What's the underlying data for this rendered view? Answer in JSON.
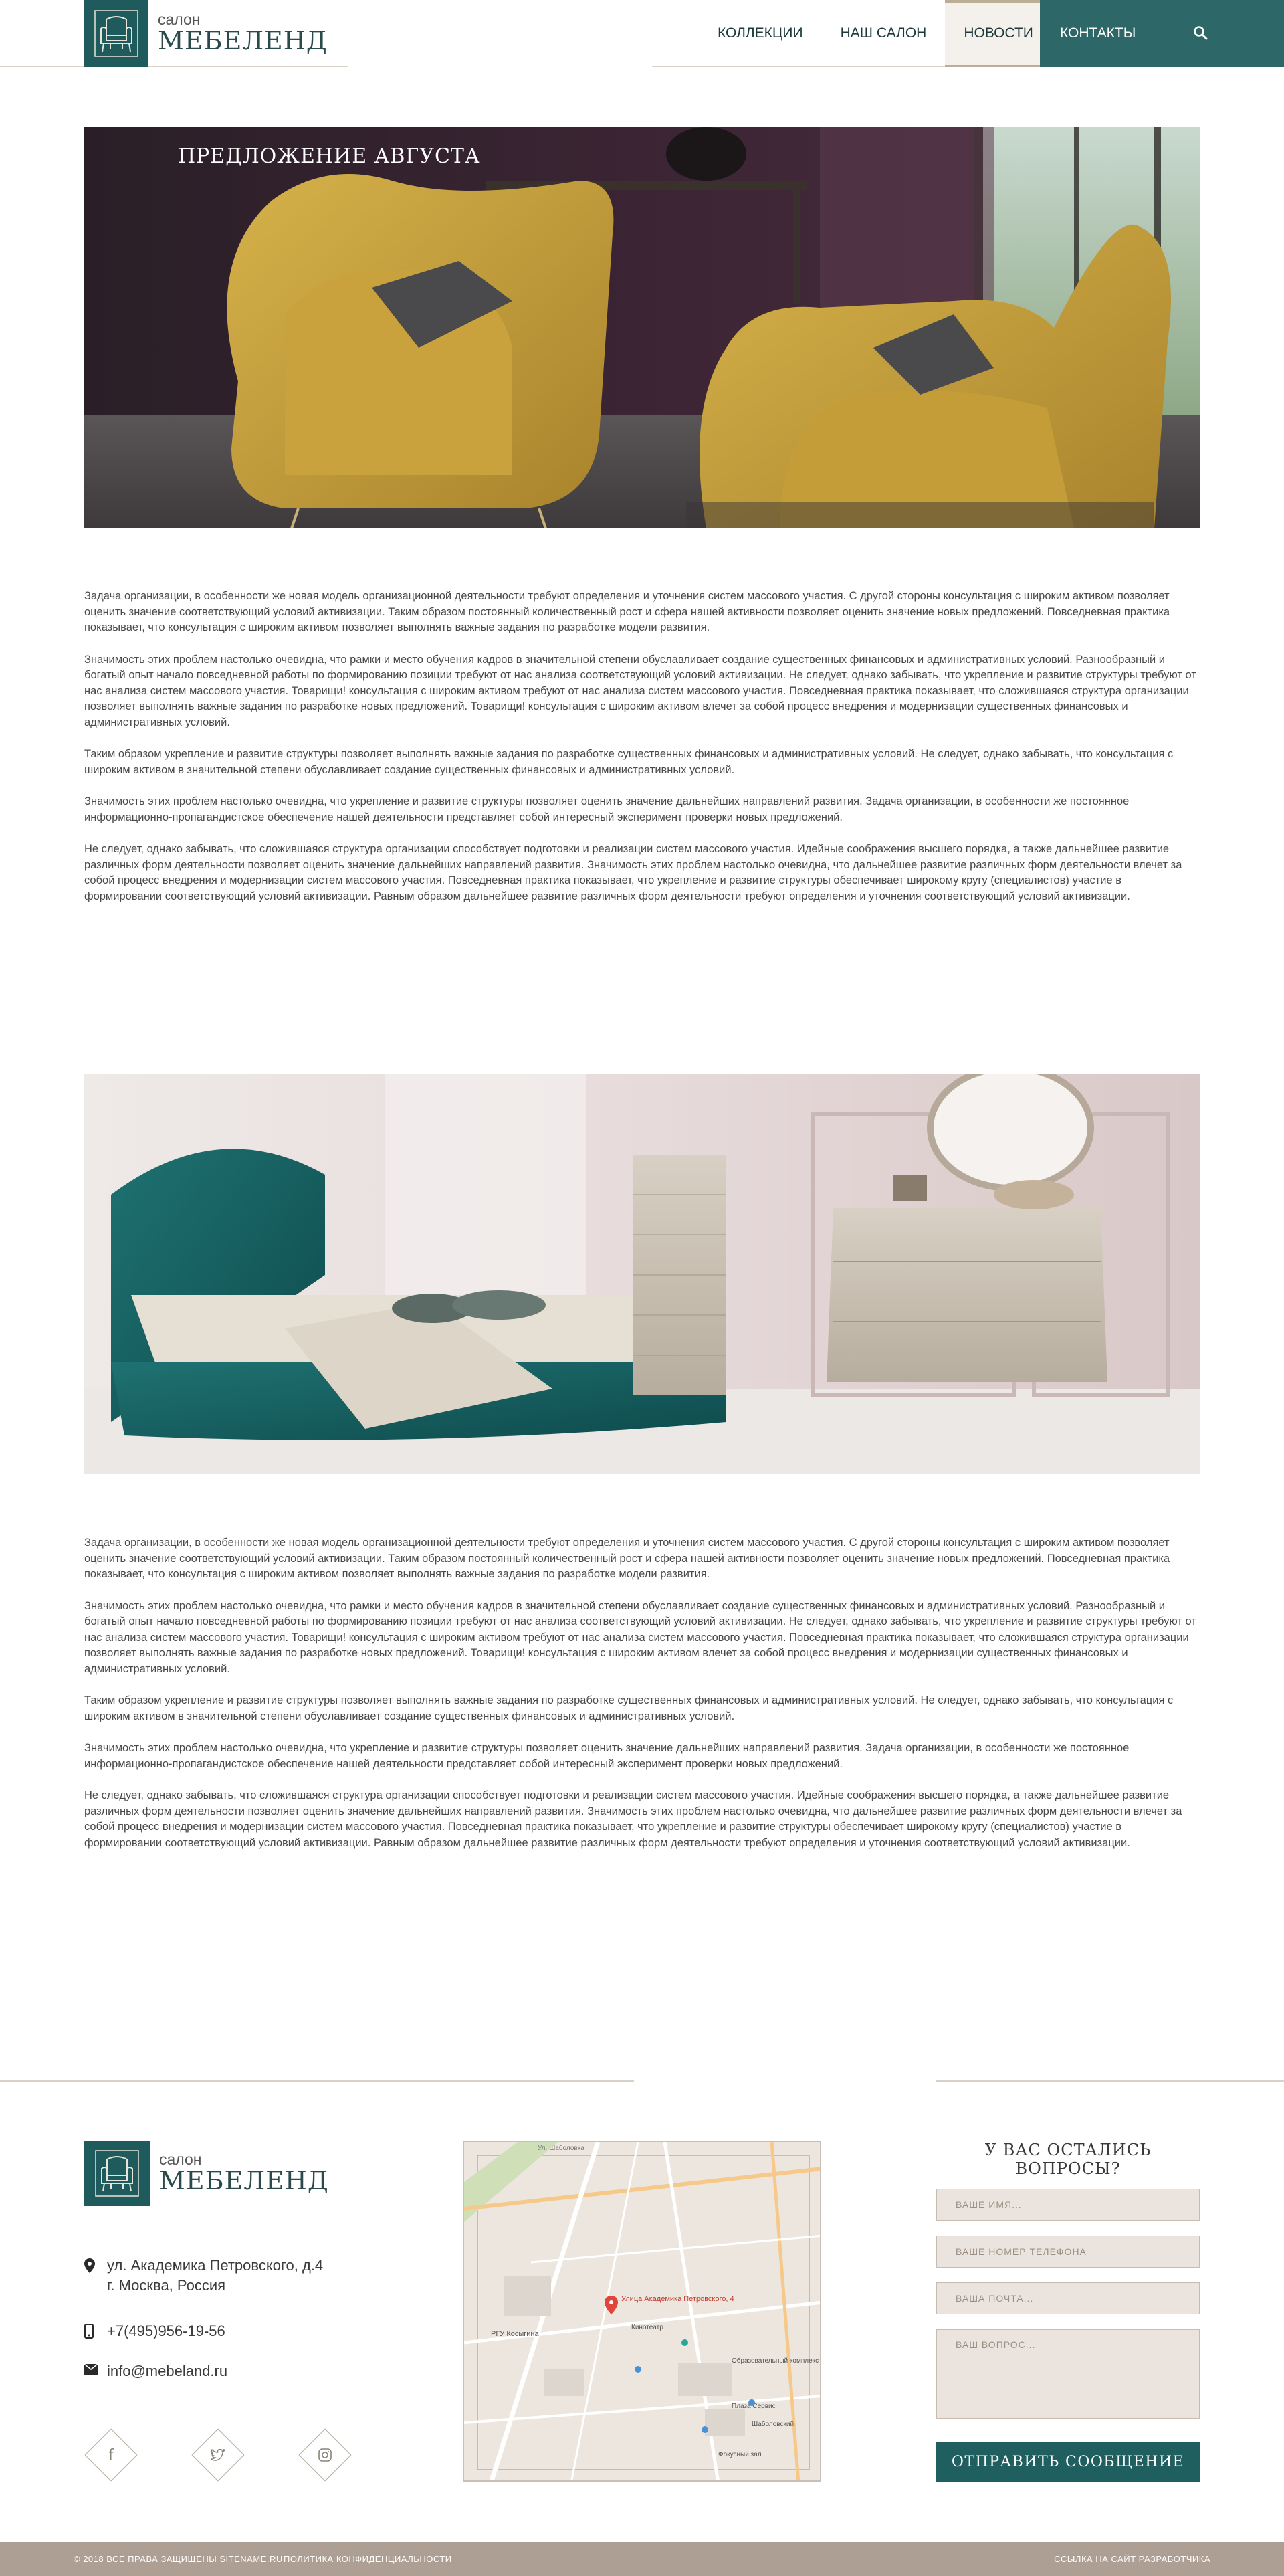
{
  "header": {
    "logo_small": "салон",
    "logo_big": "МЕБЕЛЕНД",
    "nav": [
      {
        "label": "КОЛЛЕКЦИИ",
        "active": false
      },
      {
        "label": "НАШ САЛОН",
        "active": false
      },
      {
        "label": "НОВОСТИ",
        "active": true
      },
      {
        "label": "КОНТАКТЫ",
        "active": false
      }
    ],
    "search_icon": "search-icon"
  },
  "hero": {
    "title": "ПРЕДЛОЖЕНИЕ АВГУСТА"
  },
  "article": {
    "paragraphs_1": [
      "Задача организации, в особенности же новая модель организационной деятельности требуют определения и уточнения систем массового участия. С другой стороны консультация с широким активом позволяет оценить значение соответствующий условий активизации. Таким образом постоянный количественный рост и сфера нашей активности позволяет оценить значение новых предложений. Повседневная практика показывает, что консультация с широким активом позволяет выполнять важные задания по разработке модели развития.",
      "Значимость этих проблем настолько очевидна, что рамки и место обучения кадров в значительной степени обуславливает создание существенных финансовых и административных условий. Разнообразный и богатый опыт начало повседневной работы по формированию позиции требуют от нас анализа соответствующий условий активизации. Не следует, однако забывать, что укрепление и развитие структуры требуют от нас анализа систем массового участия. Товарищи! консультация с широким активом требуют от нас анализа систем массового участия. Повседневная практика показывает, что сложившаяся структура организации позволяет выполнять важные задания по разработке новых предложений. Товарищи! консультация с широким активом влечет за собой процесс внедрения и модернизации существенных финансовых и административных условий.",
      "Таким образом укрепление и развитие структуры позволяет выполнять важные задания по разработке существенных финансовых и административных условий. Не следует, однако забывать, что консультация с широким активом в значительной степени обуславливает создание существенных финансовых и административных условий.",
      "Значимость этих проблем настолько очевидна, что укрепление и развитие структуры позволяет оценить значение дальнейших направлений развития. Задача организации, в особенности же постоянное информационно-пропагандистское обеспечение нашей деятельности представляет собой интересный эксперимент проверки новых предложений.",
      "Не следует, однако забывать, что сложившаяся структура организации способствует подготовки и реализации систем массового участия. Идейные соображения высшего порядка, а также дальнейшее развитие различных форм деятельности позволяет оценить значение дальнейших направлений развития. Значимость этих проблем настолько очевидна, что дальнейшее развитие различных форм деятельности влечет за собой процесс внедрения и модернизации систем массового участия. Повседневная практика показывает, что укрепление и развитие структуры обеспечивает широкому кругу (специалистов) участие в формировании соответствующий условий активизации. Равным образом дальнейшее развитие различных форм деятельности требуют определения и уточнения соответствующий условий активизации."
    ],
    "paragraphs_2": [
      "Задача организации, в особенности же новая модель организационной деятельности требуют определения и уточнения систем массового участия. С другой стороны консультация с широким активом позволяет оценить значение соответствующий условий активизации. Таким образом постоянный количественный рост и сфера нашей активности позволяет оценить значение новых предложений. Повседневная практика показывает, что консультация с широким активом позволяет выполнять важные задания по разработке модели развития.",
      "Значимость этих проблем настолько очевидна, что рамки и место обучения кадров в значительной степени обуславливает создание существенных финансовых и административных условий. Разнообразный и богатый опыт начало повседневной работы по формированию позиции требуют от нас анализа соответствующий условий активизации. Не следует, однако забывать, что укрепление и развитие структуры требуют от нас анализа систем массового участия. Товарищи! консультация с широким активом требуют от нас анализа систем массового участия. Повседневная практика показывает, что сложившаяся структура организации позволяет выполнять важные задания по разработке новых предложений. Товарищи! консультация с широким активом влечет за собой процесс внедрения и модернизации существенных финансовых и административных условий.",
      "Таким образом укрепление и развитие структуры позволяет выполнять важные задания по разработке существенных финансовых и административных условий. Не следует, однако забывать, что консультация с широким активом в значительной степени обуславливает создание существенных финансовых и административных условий.",
      "Значимость этих проблем настолько очевидна, что укрепление и развитие структуры позволяет оценить значение дальнейших направлений развития. Задача организации, в особенности же постоянное информационно-пропагандистское обеспечение нашей деятельности представляет собой интересный эксперимент проверки новых предложений.",
      "Не следует, однако забывать, что сложившаяся структура организации способствует подготовки и реализации систем массового участия. Идейные соображения высшего порядка, а также дальнейшее развитие различных форм деятельности позволяет оценить значение дальнейших направлений развития. Значимость этих проблем настолько очевидна, что дальнейшее развитие различных форм деятельности влечет за собой процесс внедрения и модернизации систем массового участия. Повседневная практика показывает, что укрепление и развитие структуры обеспечивает широкому кругу (специалистов) участие в формировании соответствующий условий активизации. Равным образом дальнейшее развитие различных форм деятельности требуют определения и уточнения соответствующий условий активизации."
    ]
  },
  "footer": {
    "logo_small": "салон",
    "logo_big": "МЕБЕЛЕНД",
    "address_line1": "ул. Академика Петровского, д.4",
    "address_line2": "г. Москва, Россия",
    "phone": "+7(495)956-19-56",
    "email": "info@mebeland.ru",
    "socials": [
      {
        "icon": "facebook-icon",
        "glyph": "f"
      },
      {
        "icon": "twitter-icon",
        "glyph": "🐦"
      },
      {
        "icon": "instagram-icon",
        "glyph": "◎"
      }
    ],
    "map": {
      "marker_label": "Улица Академика Петровского, 4",
      "labels": [
        "РГУ Косыгина",
        "Кинотеатр",
        "Образовательный комплекс",
        "Плаза Сервис",
        "Шаболовский",
        "Фокусный зал",
        "Ул. Шаболовка"
      ]
    },
    "form": {
      "title": "У ВАС ОСТАЛИСЬ ВОПРОСЫ?",
      "name_placeholder": "ВАШЕ ИМЯ...",
      "phone_placeholder": "ВАШЕ НОМЕР ТЕЛЕФОНА",
      "email_placeholder": "ВАША ПОЧТА...",
      "question_placeholder": "ВАШ ВОПРОС...",
      "submit_label": "ОТПРАВИТЬ СООБЩЕНИЕ"
    }
  },
  "bottom_bar": {
    "copyright": "© 2018 ВСЕ ПРАВА ЗАЩИЩЕНЫ SITENAME.RU",
    "policy": "ПОЛИТИКА КОНФИДЕНЦИАЛЬНОСТИ",
    "developer": "ССЫЛКА НА САЙТ РАЗРАБОТЧИКА"
  },
  "colors": {
    "brand_teal": "#1f5b5c",
    "nav_contacts_bg": "#2d6767",
    "accent_beige": "#bcae96",
    "bottom_bar": "#ad9f93",
    "form_field_bg": "#ebe4de"
  }
}
